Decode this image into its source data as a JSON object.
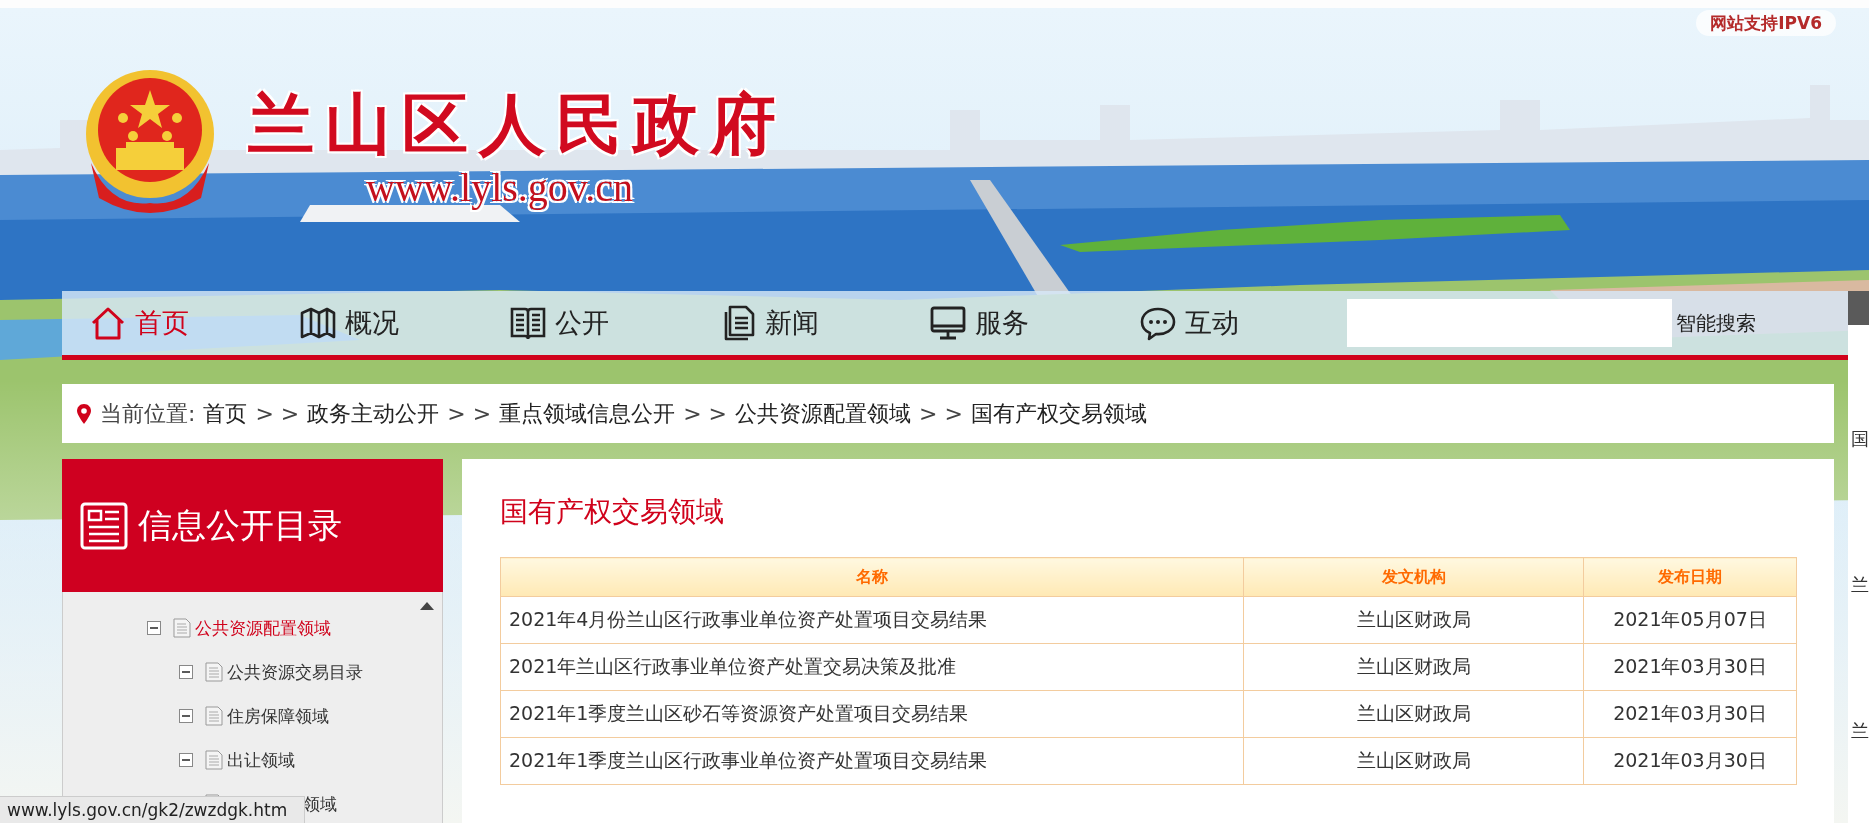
{
  "header": {
    "badge": "网站支持IPV6",
    "site_title": "兰山区人民政府",
    "site_url": "www.lyls.gov.cn"
  },
  "nav": {
    "items": [
      {
        "label": "首页",
        "kind": "home",
        "selected": true
      },
      {
        "label": "概况",
        "kind": "map",
        "selected": false
      },
      {
        "label": "公开",
        "kind": "book",
        "selected": false
      },
      {
        "label": "新闻",
        "kind": "document",
        "selected": false
      },
      {
        "label": "服务",
        "kind": "monitor",
        "selected": false
      },
      {
        "label": "互动",
        "kind": "chat",
        "selected": false
      }
    ],
    "search_button": "智能搜索"
  },
  "breadcrumb": {
    "label": "当前位置:",
    "links": [
      "首页",
      "政务主动公开",
      "重点领域信息公开",
      "公共资源配置领域",
      "国有产权交易领域"
    ],
    "separators": [
      "> >",
      "> >",
      "> >",
      "> >"
    ]
  },
  "sidebar": {
    "title": "信息公开目录",
    "tree": [
      {
        "label": "公共资源配置领域",
        "selected": true,
        "expanded": true,
        "children": [
          {
            "label": "公共资源交易目录",
            "selected": false,
            "expanded": true
          },
          {
            "label": "住房保障领域",
            "selected": false,
            "expanded": true
          },
          {
            "label": "出让领域",
            "selected": false,
            "expanded": true
          },
          {
            "label": "领域",
            "selected": false,
            "kind": "covered"
          }
        ]
      }
    ]
  },
  "content": {
    "title": "国有产权交易领域",
    "table": {
      "columns": [
        "名称",
        "发文机构",
        "发布日期"
      ],
      "rows": [
        [
          "2021年4月份兰山区行政事业单位资产处置项目交易结果",
          "兰山区财政局",
          "2021年05月07日"
        ],
        [
          "2021年兰山区行政事业单位资产处置交易决策及批准",
          "兰山区财政局",
          "2021年03月30日"
        ],
        [
          "2021年1季度兰山区砂石等资源资产处置项目交易结果",
          "兰山区财政局",
          "2021年03月30日"
        ],
        [
          "2021年1季度兰山区行政事业单位资产处置项目交易结果",
          "兰山区财政局",
          "2021年03月30日"
        ]
      ]
    }
  },
  "side_panel": {
    "items": [
      "国",
      "兰",
      "兰"
    ]
  },
  "status_bar": {
    "url": "www.lyls.gov.cn/gk2/zwzdgk.htm"
  }
}
